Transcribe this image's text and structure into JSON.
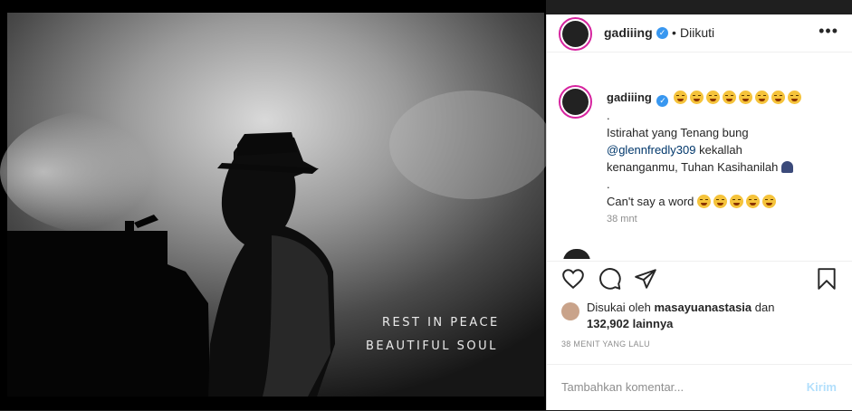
{
  "photo": {
    "caption_line1": "REST IN PEACE",
    "caption_line2": "BEAUTIFUL SOUL"
  },
  "header": {
    "username": "gadiiing",
    "separator": "•",
    "follow_status": "Diikuti",
    "more": "•••"
  },
  "comment": {
    "username": "gadiiing",
    "emoji_count": 8,
    "dot1": ".",
    "line1": "Istirahat yang Tenang bung",
    "mention": "@glennfredly309",
    "line2a": " kekallah",
    "line3": "kenanganmu, Tuhan Kasihanilah",
    "dot2": ".",
    "line4": "Can't say a word",
    "time": "38 mnt"
  },
  "likes": {
    "prefix": "Disukai oleh",
    "user": "masayuanastasia",
    "conj": "dan",
    "count": "132,902 lainnya"
  },
  "post_time": "38 MENIT YANG LALU",
  "add_comment": {
    "placeholder": "Tambahkan komentar...",
    "submit": "Kirim"
  },
  "icons": [
    "heart-icon",
    "comment-icon",
    "share-icon",
    "bookmark-icon",
    "verified-icon",
    "more-icon"
  ]
}
